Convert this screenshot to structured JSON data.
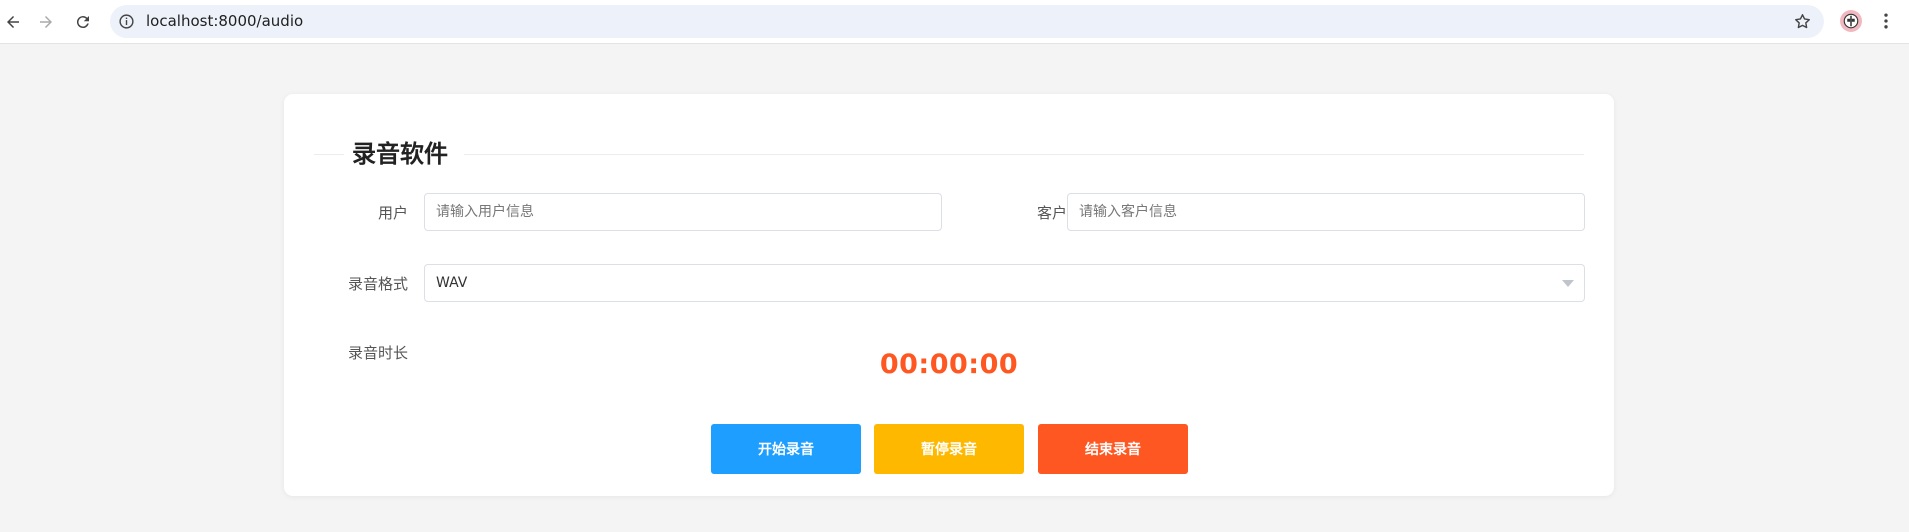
{
  "browser": {
    "url": "localhost:8000/audio",
    "icons": {
      "back": "back-arrow-icon",
      "forward": "forward-arrow-icon",
      "reload": "reload-icon",
      "site_info": "info-icon",
      "bookmark": "star-icon",
      "profile": "profile-avatar-icon",
      "menu": "kebab-menu-icon"
    }
  },
  "page": {
    "title": "录音软件",
    "user": {
      "label": "用户",
      "placeholder": "请输入用户信息",
      "value": ""
    },
    "customer": {
      "label": "客户",
      "placeholder": "请输入客户信息",
      "value": ""
    },
    "format": {
      "label": "录音格式",
      "selected": "WAV"
    },
    "duration": {
      "label": "录音时长",
      "value": "00:00:00"
    },
    "buttons": {
      "start": "开始录音",
      "pause": "暂停录音",
      "stop": "结束录音"
    }
  },
  "colors": {
    "start_button": "#1e9fff",
    "pause_button": "#ffb800",
    "stop_button": "#ff5722",
    "timer": "#ff5722"
  }
}
